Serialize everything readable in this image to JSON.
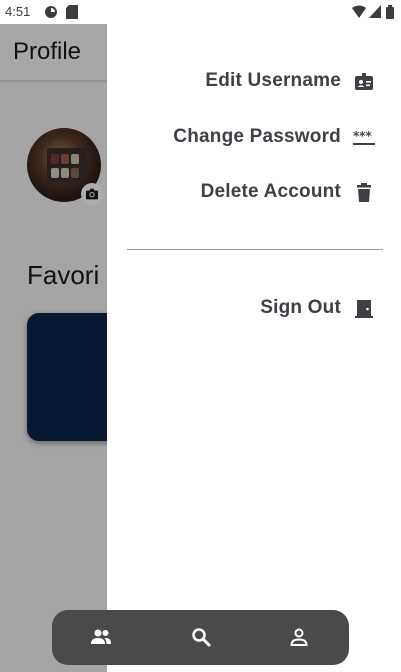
{
  "status_bar": {
    "time": "4:51",
    "icons": [
      "data-saver-icon",
      "sim-card-icon",
      "wifi-icon",
      "cell-signal-icon",
      "battery-icon"
    ]
  },
  "page": {
    "title": "Profile",
    "section_title": "Favori"
  },
  "drawer": {
    "items": [
      {
        "label": "Edit Username",
        "icon": "badge-icon"
      },
      {
        "label": "Change Password",
        "icon": "password-icon"
      },
      {
        "label": "Delete Account",
        "icon": "trash-icon"
      },
      {
        "label": "Sign Out",
        "icon": "door-icon"
      }
    ]
  },
  "bottom_nav": {
    "items": [
      {
        "icon": "people-icon"
      },
      {
        "icon": "search-icon"
      },
      {
        "icon": "person-icon"
      }
    ]
  },
  "colors": {
    "drawer_text": "#3f3f46",
    "card": "#0c244c",
    "bottom_nav": "#4a4a4a",
    "scrim": "rgba(0,0,0,0.32)"
  }
}
